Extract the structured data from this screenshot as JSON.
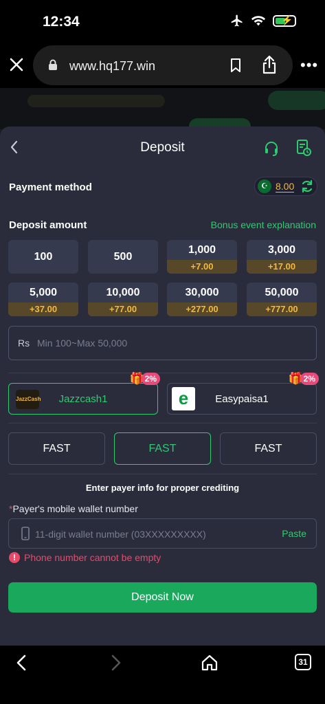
{
  "status": {
    "time": "12:34"
  },
  "browser": {
    "url": "www.hq177.win"
  },
  "header": {
    "title": "Deposit"
  },
  "payment": {
    "label": "Payment method",
    "balance": "8.00",
    "flag": "☪"
  },
  "deposit": {
    "label": "Deposit amount",
    "bonus_link": "Bonus event explanation",
    "amounts": [
      {
        "value": "100",
        "bonus": ""
      },
      {
        "value": "500",
        "bonus": ""
      },
      {
        "value": "1,000",
        "bonus": "+7.00"
      },
      {
        "value": "3,000",
        "bonus": "+17.00"
      },
      {
        "value": "5,000",
        "bonus": "+37.00"
      },
      {
        "value": "10,000",
        "bonus": "+77.00"
      },
      {
        "value": "30,000",
        "bonus": "+277.00"
      },
      {
        "value": "50,000",
        "bonus": "+777.00"
      }
    ],
    "currency": "Rs",
    "placeholder": "Min 100~Max 50,000"
  },
  "channels": [
    {
      "name": "Jazzcash1",
      "logo_text": "JazzCash",
      "promo": "2%"
    },
    {
      "name": "Easypaisa1",
      "logo_text": "e",
      "promo": "2%"
    }
  ],
  "speeds": [
    "FAST",
    "FAST",
    "FAST"
  ],
  "payer": {
    "note": "Enter payer info for proper crediting",
    "required_mark": "*",
    "wallet_label": "Payer's mobile wallet number",
    "wallet_placeholder": "11-digit wallet number (03XXXXXXXXX)",
    "paste_label": "Paste",
    "error_icon": "!",
    "error": "Phone number cannot be empty"
  },
  "submit": {
    "label": "Deposit Now"
  },
  "bottom_nav": {
    "tabs_count": "31"
  },
  "colors": {
    "accent": "#2ecb71",
    "bonus": "#f5b83a",
    "error": "#e84a6a",
    "sheet": "#2a2c3c"
  }
}
